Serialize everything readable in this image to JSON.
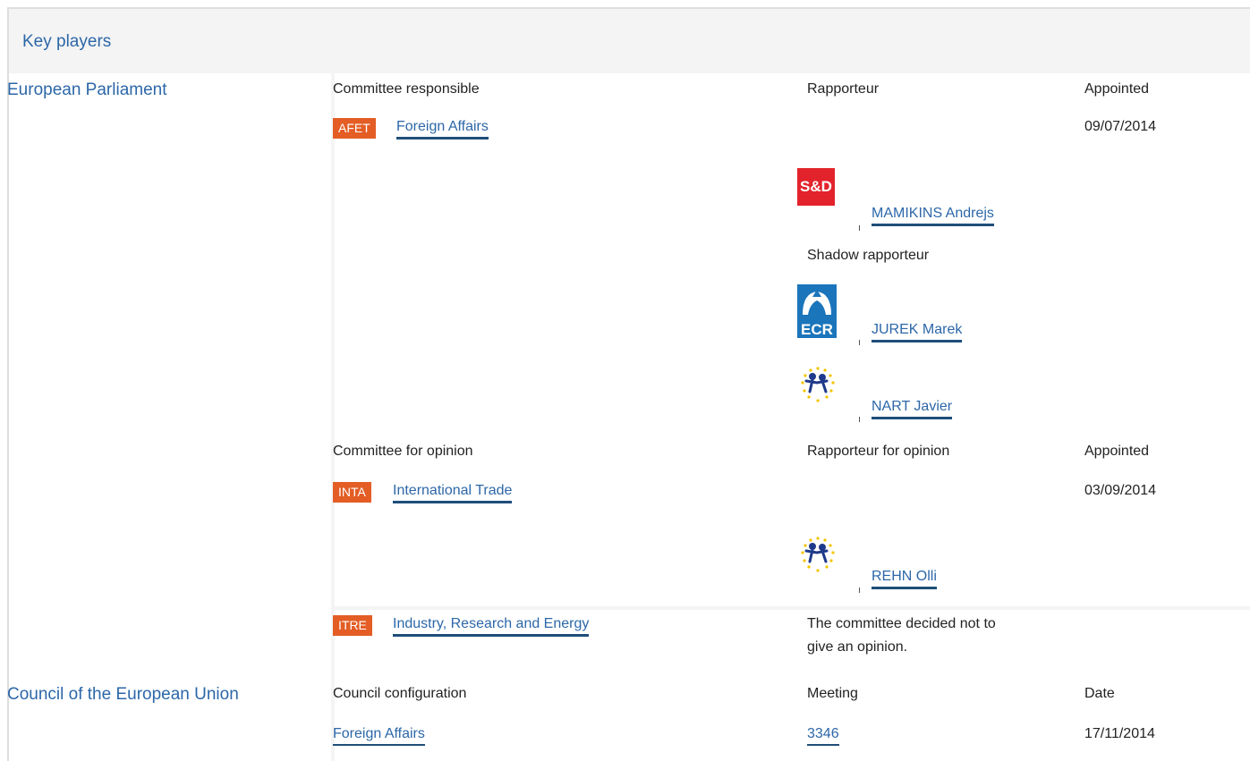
{
  "header": {
    "title": "Key players"
  },
  "ep": {
    "institution": "European Parliament",
    "committee_responsible": {
      "col_committee": "Committee responsible",
      "col_rapporteur": "Rapporteur",
      "col_appointed": "Appointed",
      "badge": "AFET",
      "committee": "Foreign Affairs",
      "appointed": "09/07/2014",
      "rapporteur": {
        "group_logo": "S&D",
        "name": "MAMIKINS Andrejs"
      },
      "shadow_label": "Shadow rapporteur",
      "shadows": [
        {
          "group_logo": "ECR",
          "name": "JUREK Marek"
        },
        {
          "group_logo": "EPP",
          "name": "NART Javier"
        }
      ]
    },
    "committee_opinion": {
      "col_committee": "Committee for opinion",
      "col_rapporteur": "Rapporteur for opinion",
      "col_appointed": "Appointed",
      "rows": [
        {
          "badge": "INTA",
          "committee": "International Trade",
          "appointed": "03/09/2014",
          "rapporteur": {
            "group_logo": "EPP",
            "name": "REHN Olli"
          }
        },
        {
          "badge": "ITRE",
          "committee": "Industry, Research and Energy",
          "note_line1": "The committee decided not to",
          "note_line2": "give an opinion."
        }
      ]
    }
  },
  "council": {
    "institution": "Council of the European Union",
    "col_configuration": "Council configuration",
    "col_meeting": "Meeting",
    "col_date": "Date",
    "configuration": "Foreign Affairs",
    "meeting": "3346",
    "date": "17/11/2014"
  },
  "colors": {
    "link": "#2c67a8",
    "badge": "#e35d25",
    "panel": "#f4f4f4"
  }
}
